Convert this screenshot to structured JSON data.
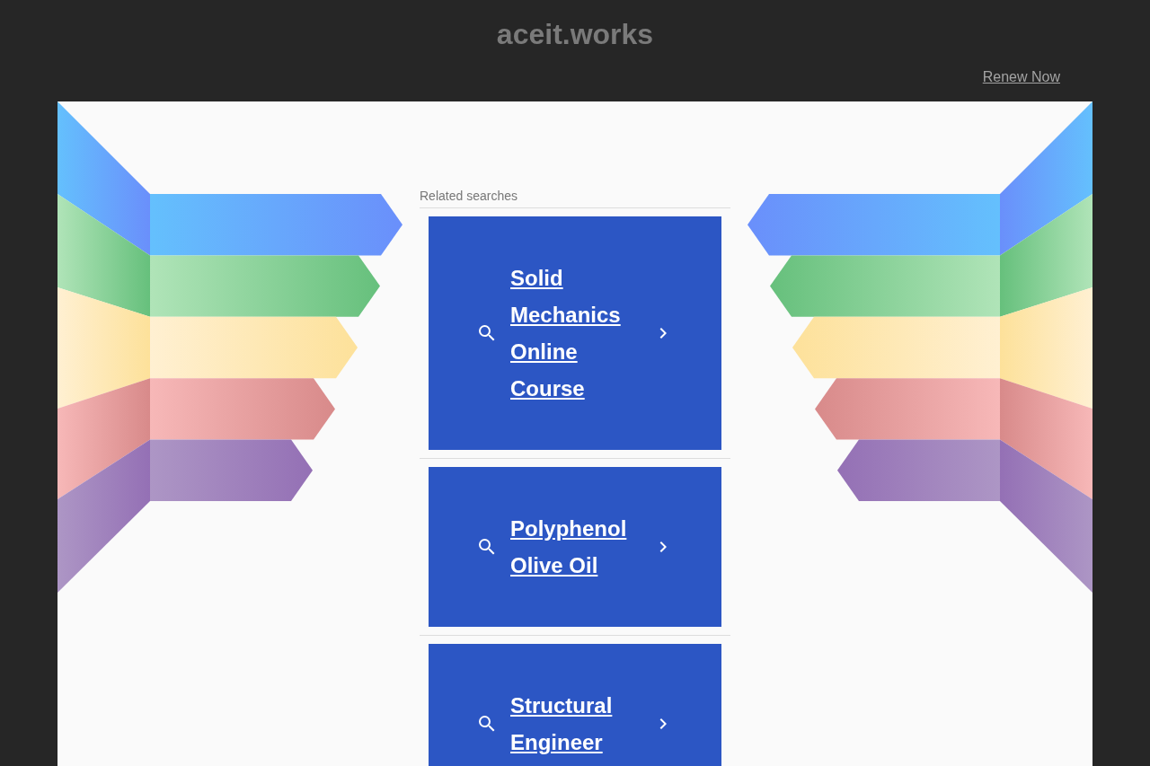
{
  "header": {
    "title": "aceit.works",
    "renew_link": "Renew Now"
  },
  "related_searches": {
    "heading": "Related searches",
    "items": [
      {
        "label": "Solid Mechanics Online Course"
      },
      {
        "label": "Polyphenol Olive Oil"
      },
      {
        "label": "Structural Engineer"
      }
    ]
  }
}
